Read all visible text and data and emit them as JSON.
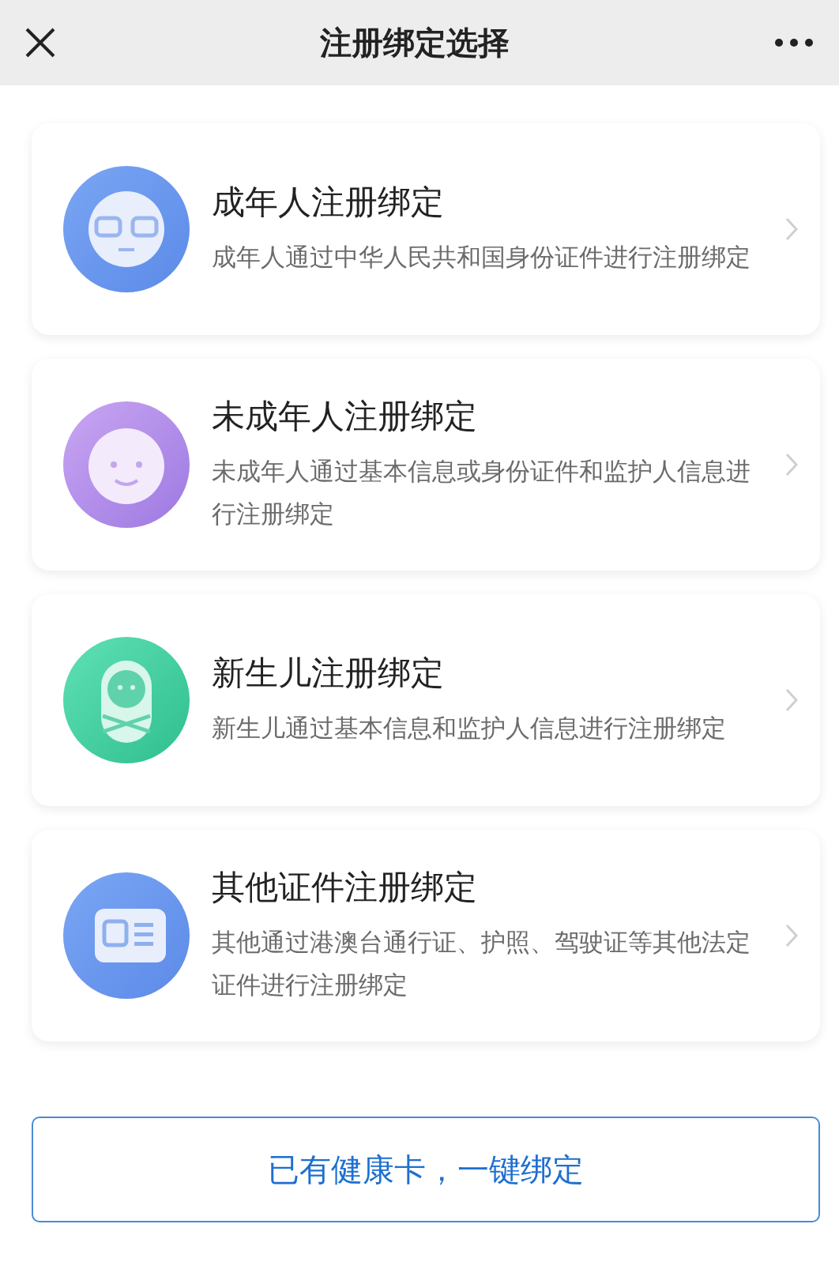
{
  "header": {
    "title": "注册绑定选择"
  },
  "options": [
    {
      "kind": "adult",
      "title": "成年人注册绑定",
      "description": "成年人通过中华人民共和国身份证件进行注册绑定"
    },
    {
      "kind": "minor",
      "title": "未成年人注册绑定",
      "description": "未成年人通过基本信息或身份证件和监护人信息进行注册绑定"
    },
    {
      "kind": "newborn",
      "title": "新生儿注册绑定",
      "description": "新生儿通过基本信息和监护人信息进行注册绑定"
    },
    {
      "kind": "other",
      "title": "其他证件注册绑定",
      "description": "其他通过港澳台通行证、护照、驾驶证等其他法定证件进行注册绑定"
    }
  ],
  "bind_button": {
    "label": "已有健康卡，一键绑定"
  }
}
